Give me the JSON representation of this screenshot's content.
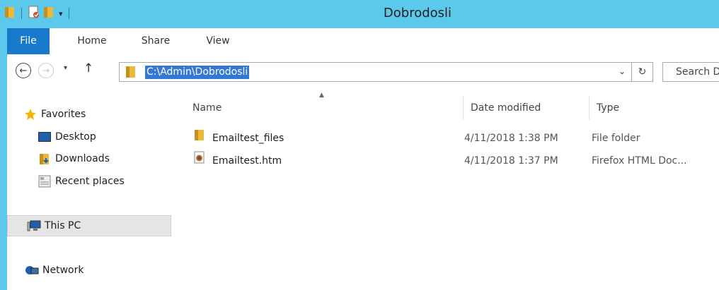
{
  "window": {
    "title": "Dobrodosli"
  },
  "ribbon": {
    "tabs": [
      "File",
      "Home",
      "Share",
      "View"
    ]
  },
  "address": {
    "path": "C:\\Admin\\Dobrodosli",
    "search_placeholder": "Search D"
  },
  "nav": {
    "favorites": "Favorites",
    "desktop": "Desktop",
    "downloads": "Downloads",
    "recent": "Recent places",
    "this_pc": "This PC",
    "network": "Network"
  },
  "columns": {
    "name": "Name",
    "date": "Date modified",
    "type": "Type"
  },
  "files": [
    {
      "name": "Emailtest_files",
      "date": "4/11/2018 1:38 PM",
      "type": "File folder",
      "icon": "folder-icon"
    },
    {
      "name": "Emailtest.htm",
      "date": "4/11/2018 1:37 PM",
      "type": "Firefox HTML Doc...",
      "icon": "firefox-document-icon"
    }
  ],
  "colors": {
    "titlebar": "#5bc8ec",
    "file_tab": "#1979ca",
    "selection": "#3378d6"
  }
}
